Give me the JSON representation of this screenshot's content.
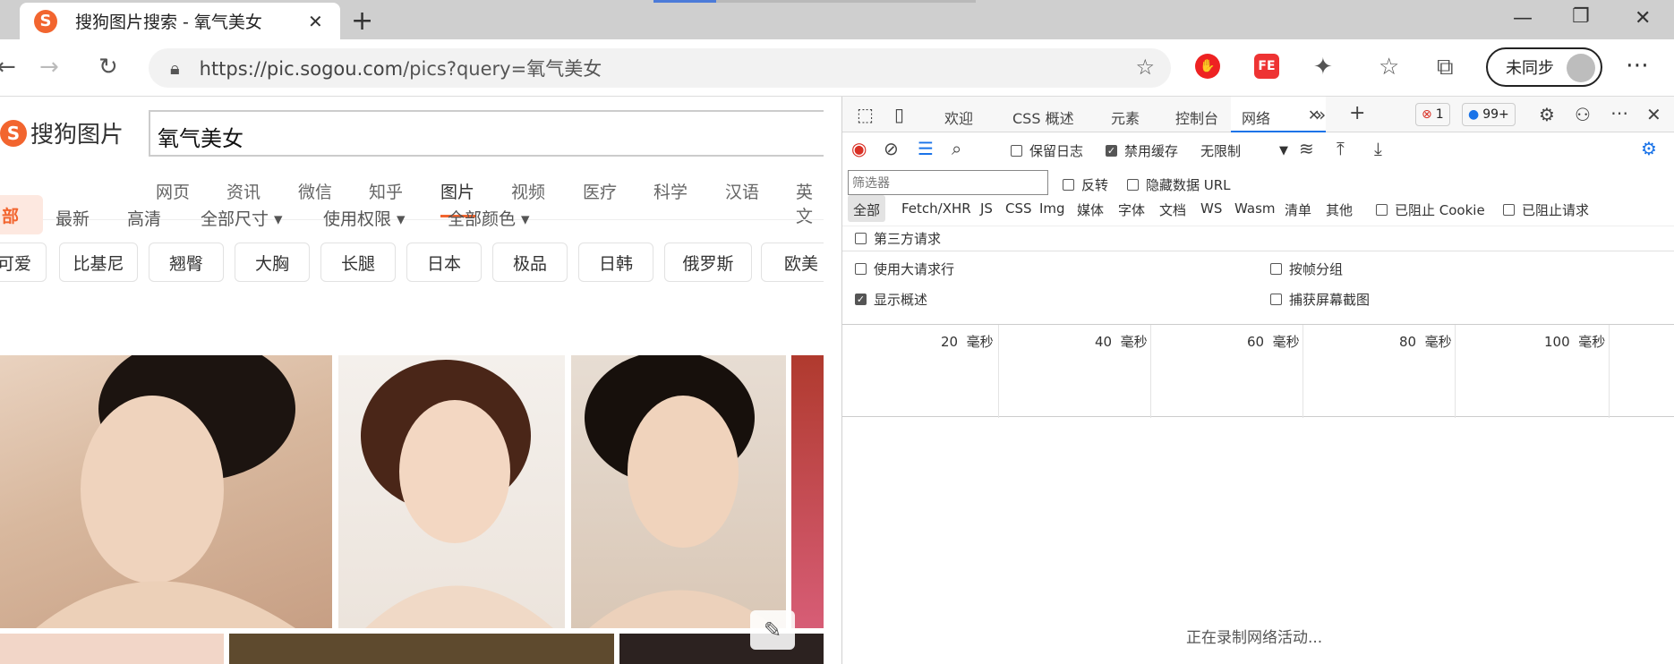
{
  "browser": {
    "tab_title": "搜狗图片搜索 - 氧气美女",
    "tab_icon_letter": "S",
    "url_host": "https://pic.sogou.com",
    "url_path": "/pics?query=氧气美女",
    "sync_label": "未同步"
  },
  "page": {
    "logo_text": "搜狗图片",
    "logo_letter": "S",
    "search_value": "氧气美女",
    "nav": [
      "网页",
      "资讯",
      "微信",
      "知乎",
      "图片",
      "视频",
      "医疗",
      "科学",
      "汉语",
      "英文"
    ],
    "filter_all": "部",
    "filters": [
      "最新",
      "高清",
      "全部尺寸 ▾",
      "使用权限 ▾",
      "全部颜色 ▾"
    ],
    "tags": [
      "可爱",
      "比基尼",
      "翘臀",
      "大胸",
      "长腿",
      "日本",
      "极品",
      "日韩",
      "俄罗斯",
      "欧美"
    ]
  },
  "devtools": {
    "tabs": [
      "欢迎",
      "CSS 概述",
      "元素",
      "控制台",
      "网络"
    ],
    "error_count": "1",
    "message_count": "99+",
    "preserve_log": "保留日志",
    "disable_cache": "禁用缓存",
    "throttle": "无限制",
    "filter_placeholder": "筛选器",
    "invert": "反转",
    "hide_data_url": "隐藏数据 URL",
    "types": [
      "全部",
      "Fetch/XHR",
      "JS",
      "CSS",
      "Img",
      "媒体",
      "字体",
      "文档",
      "WS",
      "Wasm",
      "清单",
      "其他"
    ],
    "blocked_cookies": "已阻止 Cookie",
    "blocked_requests": "已阻止请求",
    "third_party": "第三方请求",
    "large_rows": "使用大请求行",
    "group_by_frame": "按帧分组",
    "show_overview": "显示概述",
    "capture_screenshots": "捕获屏幕截图",
    "timeline_ticks": [
      "20",
      "40",
      "60",
      "80",
      "100"
    ],
    "timeline_unit": "毫秒",
    "recording_text": "正在录制网络活动..."
  },
  "colors": {
    "brand": "#f2652f",
    "accent": "#1a73e8"
  }
}
